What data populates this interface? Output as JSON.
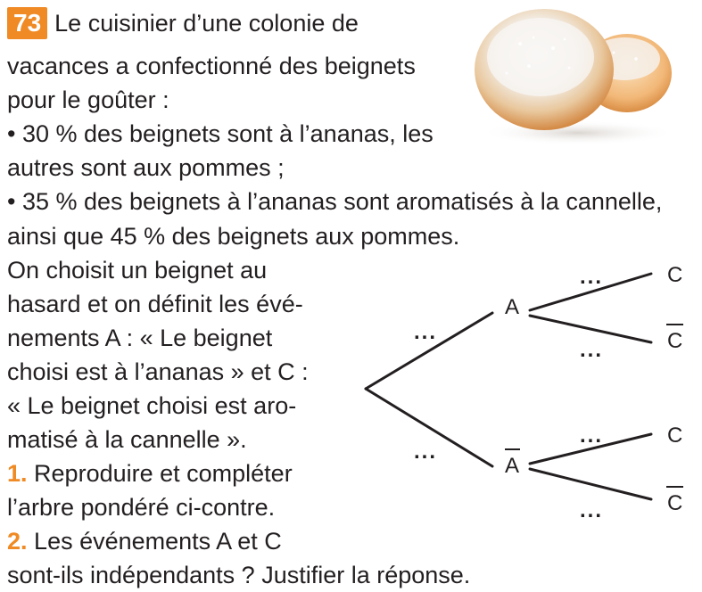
{
  "exercise": {
    "number": "73",
    "lines": [
      "Le cuisinier d’une colonie de",
      "vacances a confectionné des beignets",
      "pour le goûter :",
      "• 30 % des beignets sont à l’ananas, les",
      "autres sont aux pommes ;",
      "• 35 % des beignets à l’ananas sont aromatisés à la cannelle,",
      "ainsi que 45 % des beignets aux pommes.",
      "On choisit un beignet au",
      "hasard et on définit les évé-",
      "nements A : « Le beignet",
      "choisi est à l’ananas » et C :",
      "« Le beignet choisi est aro-",
      "matisé à la cannelle »."
    ],
    "questions": [
      {
        "num": "1.",
        "lines": [
          "Reproduire et compléter",
          "l’arbre pondéré ci-contre."
        ]
      },
      {
        "num": "2.",
        "lines": [
          "Les événements A et C",
          "sont-ils indépendants ? Justifier la réponse."
        ]
      }
    ]
  },
  "tree": {
    "node_a": "A",
    "node_a_bar": "A",
    "leaf_c": "C",
    "leaf_c_bar": "C",
    "placeholder": "..."
  },
  "colors": {
    "accent": "#f08a24",
    "text": "#231f20"
  }
}
